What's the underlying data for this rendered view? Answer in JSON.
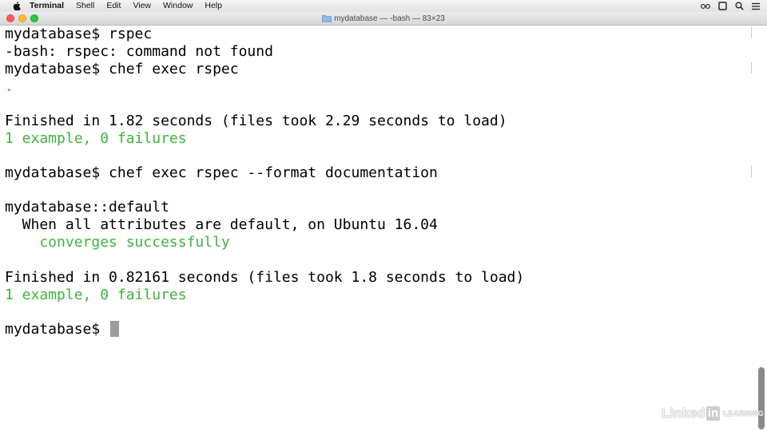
{
  "menubar": {
    "app_name": "Terminal",
    "items": [
      "Shell",
      "Edit",
      "View",
      "Window",
      "Help"
    ],
    "right_icons": [
      "glasses-icon",
      "screen-icon",
      "search-icon",
      "list-icon"
    ]
  },
  "window": {
    "title": "mydatabase — -bash — 83×23",
    "folder_icon": "folder-icon"
  },
  "terminal": {
    "lines": [
      {
        "text": "mydatabase$ rspec",
        "color": "#000000"
      },
      {
        "text": "-bash: rspec: command not found",
        "color": "#000000"
      },
      {
        "text": "mydatabase$ chef exec rspec",
        "color": "#000000"
      },
      {
        "text": ".",
        "color": "#3cb43c"
      },
      {
        "text": "",
        "color": "#000000"
      },
      {
        "text": "Finished in 1.82 seconds (files took 2.29 seconds to load)",
        "color": "#000000"
      },
      {
        "text": "1 example, 0 failures",
        "color": "#3cb43c"
      },
      {
        "text": "",
        "color": "#000000"
      },
      {
        "text": "mydatabase$ chef exec rspec --format documentation",
        "color": "#000000"
      },
      {
        "text": "",
        "color": "#000000"
      },
      {
        "text": "mydatabase::default",
        "color": "#000000"
      },
      {
        "text": "  When all attributes are default, on Ubuntu 16.04",
        "color": "#000000"
      },
      {
        "text": "    converges successfully",
        "color": "#3cb43c"
      },
      {
        "text": "",
        "color": "#000000"
      },
      {
        "text": "Finished in 0.82161 seconds (files took 1.8 seconds to load)",
        "color": "#000000"
      },
      {
        "text": "1 example, 0 failures",
        "color": "#3cb43c"
      },
      {
        "text": "",
        "color": "#000000"
      },
      {
        "text": "mydatabase$ ",
        "color": "#000000"
      }
    ]
  },
  "watermark": {
    "brand_left": "Linked",
    "brand_box": "in",
    "brand_sub": "LEARNING"
  }
}
